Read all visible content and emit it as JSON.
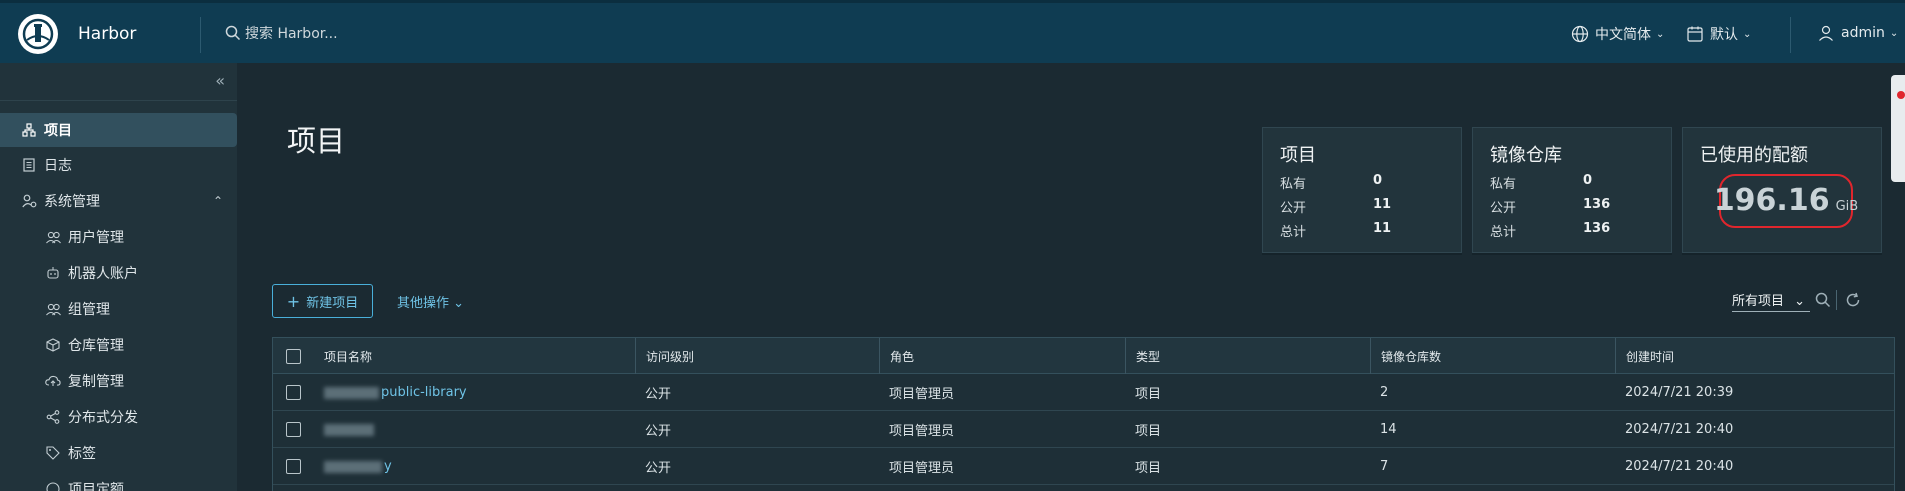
{
  "header": {
    "app_name": "Harbor",
    "search_placeholder": "搜索 Harbor...",
    "language": "中文简体",
    "datetime_format": "默认",
    "user": "admin"
  },
  "sidebar": {
    "items": [
      {
        "label": "项目",
        "icon": "projects-icon",
        "active": true
      },
      {
        "label": "日志",
        "icon": "log-icon"
      },
      {
        "label": "系统管理",
        "icon": "admin-icon",
        "expanded": true
      },
      {
        "label": "用户管理",
        "icon": "users-icon"
      },
      {
        "label": "机器人账户",
        "icon": "robot-icon"
      },
      {
        "label": "组管理",
        "icon": "group-icon"
      },
      {
        "label": "仓库管理",
        "icon": "registry-icon"
      },
      {
        "label": "复制管理",
        "icon": "replication-icon"
      },
      {
        "label": "分布式分发",
        "icon": "share-icon"
      },
      {
        "label": "标签",
        "icon": "tag-icon"
      },
      {
        "label": "项目定额",
        "icon": "quota-icon"
      }
    ]
  },
  "main": {
    "title": "项目",
    "cards": {
      "projects": {
        "title": "项目",
        "private_label": "私有",
        "private": "0",
        "public_label": "公开",
        "public": "11",
        "total_label": "总计",
        "total": "11"
      },
      "repos": {
        "title": "镜像仓库",
        "private_label": "私有",
        "private": "0",
        "public_label": "公开",
        "public": "136",
        "total_label": "总计",
        "total": "136"
      },
      "quota": {
        "title": "已使用的配额",
        "value": "196.16",
        "unit": "GiB"
      }
    },
    "new_project_label": "新建项目",
    "other_actions_label": "其他操作",
    "filter_label": "所有项目"
  },
  "table": {
    "columns": [
      "项目名称",
      "访问级别",
      "角色",
      "类型",
      "镜像仓库数",
      "创建时间"
    ],
    "rows": [
      {
        "name": "public-library",
        "access": "公开",
        "role": "项目管理员",
        "type": "项目",
        "repo_count": "2",
        "created": "2024/7/21 20:39"
      },
      {
        "name": "",
        "access": "公开",
        "role": "项目管理员",
        "type": "项目",
        "repo_count": "14",
        "created": "2024/7/21 20:40"
      },
      {
        "name": "y",
        "access": "公开",
        "role": "项目管理员",
        "type": "项目",
        "repo_count": "7",
        "created": "2024/7/21 20:40"
      }
    ]
  },
  "colors": {
    "header_bg": "#0f3c52",
    "sidebar_bg": "#21333b",
    "page_bg": "#1b2a32",
    "accent": "#49afd9",
    "quota_highlight": "#e0262d"
  }
}
